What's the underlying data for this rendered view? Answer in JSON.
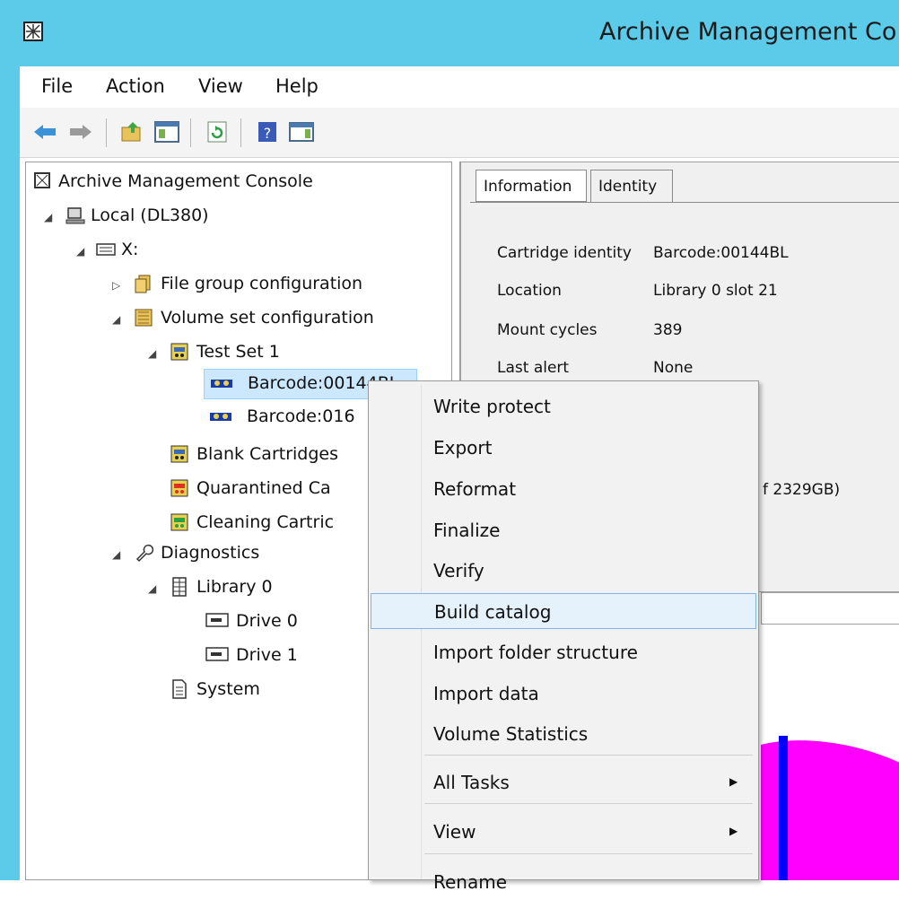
{
  "window": {
    "title": "Archive Management Co"
  },
  "menubar": {
    "items": [
      "File",
      "Action",
      "View",
      "Help"
    ]
  },
  "toolbar": {
    "buttons": [
      "back-icon",
      "forward-icon",
      "up-folder-icon",
      "show-hide-tree-icon",
      "refresh-icon",
      "help-icon",
      "action-pane-icon"
    ]
  },
  "tree": {
    "root": "Archive Management Console",
    "local": "Local (DL380)",
    "drive": "X:",
    "file_group": "File group configuration",
    "volume_set": "Volume set configuration",
    "test_set": "Test Set 1",
    "barcode1": "Barcode:00144BL",
    "barcode2": "Barcode:016",
    "blank": "Blank Cartridges",
    "quarantined": "Quarantined Ca",
    "cleaning": "Cleaning Cartric",
    "diagnostics": "Diagnostics",
    "library": "Library 0",
    "drive0": "Drive 0",
    "drive1": "Drive 1",
    "system": "System"
  },
  "details": {
    "tabs": [
      "Information",
      "Identity"
    ],
    "rows": [
      {
        "label": "Cartridge identity",
        "value": "Barcode:00144BL"
      },
      {
        "label": "Location",
        "value": "Library 0 slot 21"
      },
      {
        "label": "Mount cycles",
        "value": "389"
      },
      {
        "label": "Last alert",
        "value": "None"
      }
    ],
    "capacity_fragment": "f 2329GB)"
  },
  "context_menu": {
    "items": [
      {
        "label": "Write protect"
      },
      {
        "label": "Export"
      },
      {
        "label": "Reformat"
      },
      {
        "label": "Finalize"
      },
      {
        "label": "Verify"
      },
      {
        "label": "Build catalog",
        "highlighted": true
      },
      {
        "label": "Import folder structure"
      },
      {
        "label": "Import data"
      },
      {
        "label": "Volume Statistics"
      },
      {
        "label": "All Tasks",
        "submenu": true
      },
      {
        "label": "View",
        "submenu": true
      },
      {
        "label": "Rename"
      }
    ]
  },
  "colors": {
    "titlebar": "#5ccbe9",
    "selection": "#cce8ff",
    "menu_highlight": "#e5f1fb",
    "chart_magenta": "#ff00ff",
    "chart_blue": "#0000ff"
  }
}
